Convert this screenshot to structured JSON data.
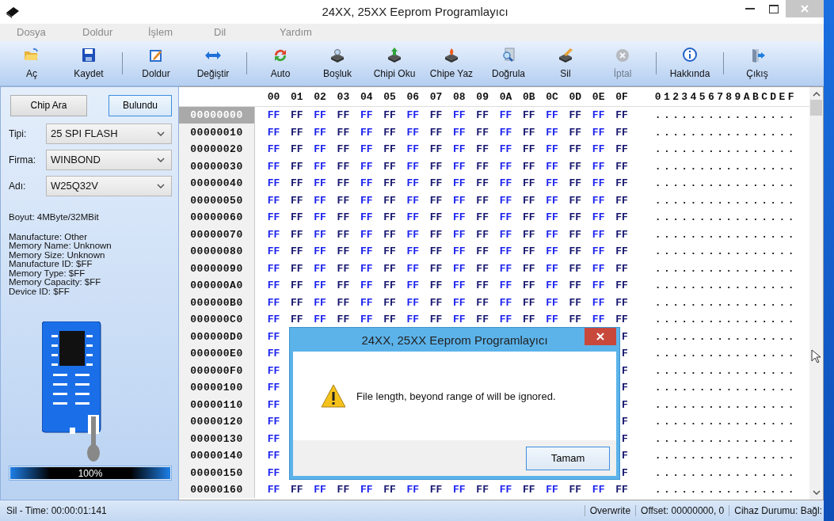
{
  "window": {
    "title": "24XX, 25XX Eeprom Programlayıcı"
  },
  "menu": [
    {
      "label": "Dosya",
      "disabled": true
    },
    {
      "label": "Doldur",
      "disabled": true
    },
    {
      "label": "İşlem",
      "disabled": true
    },
    {
      "label": "Dil",
      "disabled": true
    },
    {
      "label": "Yardım",
      "disabled": true
    }
  ],
  "toolbar": [
    {
      "kind": "button",
      "label": "Aç",
      "disabled": false
    },
    {
      "kind": "button",
      "label": "Kaydet",
      "disabled": false
    },
    {
      "kind": "separator"
    },
    {
      "kind": "button",
      "label": "Doldur",
      "disabled": false
    },
    {
      "kind": "button",
      "label": "Değiştir",
      "disabled": false
    },
    {
      "kind": "separator"
    },
    {
      "kind": "button",
      "label": "Auto",
      "disabled": false
    },
    {
      "kind": "button",
      "label": "Boşluk",
      "disabled": false
    },
    {
      "kind": "button",
      "label": "Chipi Oku",
      "disabled": false
    },
    {
      "kind": "button",
      "label": "Chipe Yaz",
      "disabled": false
    },
    {
      "kind": "button",
      "label": "Doğrula",
      "disabled": false
    },
    {
      "kind": "button",
      "label": "Sil",
      "disabled": false
    },
    {
      "kind": "button",
      "label": "İptal",
      "disabled": true
    },
    {
      "kind": "separator"
    },
    {
      "kind": "button",
      "label": "Hakkında",
      "disabled": false
    },
    {
      "kind": "separator"
    },
    {
      "kind": "button",
      "label": "Çıkış",
      "disabled": false
    }
  ],
  "chip_panel": {
    "buttons": [
      {
        "label": "Chip Ara",
        "focused": false
      },
      {
        "label": "Bulundu",
        "focused": true
      }
    ],
    "fields": [
      {
        "label": "Tipi:",
        "value": "25 SPI FLASH"
      },
      {
        "label": "Firma:",
        "value": "WINBOND"
      },
      {
        "label": "Adı:",
        "value": "W25Q32V"
      }
    ],
    "size": "Boyut:  4MByte/32MBit",
    "info": [
      "Manufacture: Other",
      "Memory Name: Unknown",
      "Memory Size: Unknown",
      "Manufacture ID: $FF",
      "Memory Type: $FF",
      "Memory Capacity: $FF",
      "Device ID: $FF"
    ],
    "progress": {
      "level": 1,
      "text": "100%"
    }
  },
  "hex": {
    "columns": [
      "00",
      "01",
      "02",
      "03",
      "04",
      "05",
      "06",
      "07",
      "08",
      "09",
      "0A",
      "0B",
      "0C",
      "0D",
      "0E",
      "0F"
    ],
    "ascii_header": "0123456789ABCDEF",
    "rows": [
      {
        "address": "00000000",
        "selected": true,
        "covered": false,
        "bytes": [
          "FF",
          "FF",
          "FF",
          "FF",
          "FF",
          "FF",
          "FF",
          "FF",
          "FF",
          "FF",
          "FF",
          "FF",
          "FF",
          "FF",
          "FF",
          "FF"
        ],
        "ascii": "................"
      },
      {
        "address": "00000010",
        "selected": false,
        "covered": false,
        "bytes": [
          "FF",
          "FF",
          "FF",
          "FF",
          "FF",
          "FF",
          "FF",
          "FF",
          "FF",
          "FF",
          "FF",
          "FF",
          "FF",
          "FF",
          "FF",
          "FF"
        ],
        "ascii": "................"
      },
      {
        "address": "00000020",
        "selected": false,
        "covered": false,
        "bytes": [
          "FF",
          "FF",
          "FF",
          "FF",
          "FF",
          "FF",
          "FF",
          "FF",
          "FF",
          "FF",
          "FF",
          "FF",
          "FF",
          "FF",
          "FF",
          "FF"
        ],
        "ascii": "................"
      },
      {
        "address": "00000030",
        "selected": false,
        "covered": false,
        "bytes": [
          "FF",
          "FF",
          "FF",
          "FF",
          "FF",
          "FF",
          "FF",
          "FF",
          "FF",
          "FF",
          "FF",
          "FF",
          "FF",
          "FF",
          "FF",
          "FF"
        ],
        "ascii": "................"
      },
      {
        "address": "00000040",
        "selected": false,
        "covered": false,
        "bytes": [
          "FF",
          "FF",
          "FF",
          "FF",
          "FF",
          "FF",
          "FF",
          "FF",
          "FF",
          "FF",
          "FF",
          "FF",
          "FF",
          "FF",
          "FF",
          "FF"
        ],
        "ascii": "................"
      },
      {
        "address": "00000050",
        "selected": false,
        "covered": false,
        "bytes": [
          "FF",
          "FF",
          "FF",
          "FF",
          "FF",
          "FF",
          "FF",
          "FF",
          "FF",
          "FF",
          "FF",
          "FF",
          "FF",
          "FF",
          "FF",
          "FF"
        ],
        "ascii": "................"
      },
      {
        "address": "00000060",
        "selected": false,
        "covered": false,
        "bytes": [
          "FF",
          "FF",
          "FF",
          "FF",
          "FF",
          "FF",
          "FF",
          "FF",
          "FF",
          "FF",
          "FF",
          "FF",
          "FF",
          "FF",
          "FF",
          "FF"
        ],
        "ascii": "................"
      },
      {
        "address": "00000070",
        "selected": false,
        "covered": false,
        "bytes": [
          "FF",
          "FF",
          "FF",
          "FF",
          "FF",
          "FF",
          "FF",
          "FF",
          "FF",
          "FF",
          "FF",
          "FF",
          "FF",
          "FF",
          "FF",
          "FF"
        ],
        "ascii": "................"
      },
      {
        "address": "00000080",
        "selected": false,
        "covered": false,
        "bytes": [
          "FF",
          "FF",
          "FF",
          "FF",
          "FF",
          "FF",
          "FF",
          "FF",
          "FF",
          "FF",
          "FF",
          "FF",
          "FF",
          "FF",
          "FF",
          "FF"
        ],
        "ascii": "................"
      },
      {
        "address": "00000090",
        "selected": false,
        "covered": false,
        "bytes": [
          "FF",
          "FF",
          "FF",
          "FF",
          "FF",
          "FF",
          "FF",
          "FF",
          "FF",
          "FF",
          "FF",
          "FF",
          "FF",
          "FF",
          "FF",
          "FF"
        ],
        "ascii": "................"
      },
      {
        "address": "000000A0",
        "selected": false,
        "covered": false,
        "bytes": [
          "FF",
          "FF",
          "FF",
          "FF",
          "FF",
          "FF",
          "FF",
          "FF",
          "FF",
          "FF",
          "FF",
          "FF",
          "FF",
          "FF",
          "FF",
          "FF"
        ],
        "ascii": "................"
      },
      {
        "address": "000000B0",
        "selected": false,
        "covered": false,
        "bytes": [
          "FF",
          "FF",
          "FF",
          "FF",
          "FF",
          "FF",
          "FF",
          "FF",
          "FF",
          "FF",
          "FF",
          "FF",
          "FF",
          "FF",
          "FF",
          "FF"
        ],
        "ascii": "................"
      },
      {
        "address": "000000C0",
        "selected": false,
        "covered": false,
        "bytes": [
          "FF",
          "FF",
          "FF",
          "FF",
          "FF",
          "FF",
          "FF",
          "FF",
          "FF",
          "FF",
          "FF",
          "FF",
          "FF",
          "FF",
          "FF",
          "FF"
        ],
        "ascii": "................"
      },
      {
        "address": "000000D0",
        "selected": false,
        "covered": true,
        "bytes": [
          "FF",
          "F"
        ],
        "ascii": "................"
      },
      {
        "address": "000000E0",
        "selected": false,
        "covered": true,
        "bytes": [
          "FF",
          "F"
        ],
        "ascii": "................"
      },
      {
        "address": "000000F0",
        "selected": false,
        "covered": true,
        "bytes": [
          "FF",
          "F"
        ],
        "ascii": "................"
      },
      {
        "address": "00000100",
        "selected": false,
        "covered": true,
        "bytes": [
          "FF",
          "F"
        ],
        "ascii": "................"
      },
      {
        "address": "00000110",
        "selected": false,
        "covered": true,
        "bytes": [
          "FF",
          "F"
        ],
        "ascii": "................"
      },
      {
        "address": "00000120",
        "selected": false,
        "covered": true,
        "bytes": [
          "FF",
          "F"
        ],
        "ascii": "................"
      },
      {
        "address": "00000130",
        "selected": false,
        "covered": true,
        "bytes": [
          "FF",
          "F"
        ],
        "ascii": "................"
      },
      {
        "address": "00000140",
        "selected": false,
        "covered": true,
        "bytes": [
          "FF",
          "F"
        ],
        "ascii": "................"
      },
      {
        "address": "00000150",
        "selected": false,
        "covered": true,
        "bytes": [
          "FF",
          "F"
        ],
        "ascii": "................"
      },
      {
        "address": "00000160",
        "selected": false,
        "covered": false,
        "bytes": [
          "FF",
          "FF",
          "FF",
          "FF",
          "FF",
          "FF",
          "FF",
          "FF",
          "FF",
          "FF",
          "FF",
          "FF",
          "FF",
          "FF",
          "FF",
          "FF"
        ],
        "ascii": "................"
      }
    ]
  },
  "status_bar": {
    "message": "Sil - Time: 00:00:01:141",
    "mode": "Overwrite",
    "offset": "Offset: 00000000, 0",
    "device": "Cihaz Durumu: Bağl:"
  },
  "dialog": {
    "title": "24XX, 25XX Eeprom Programlayıcı",
    "message": "File length, beyond range of will be ignored.",
    "button": "Tamam"
  }
}
